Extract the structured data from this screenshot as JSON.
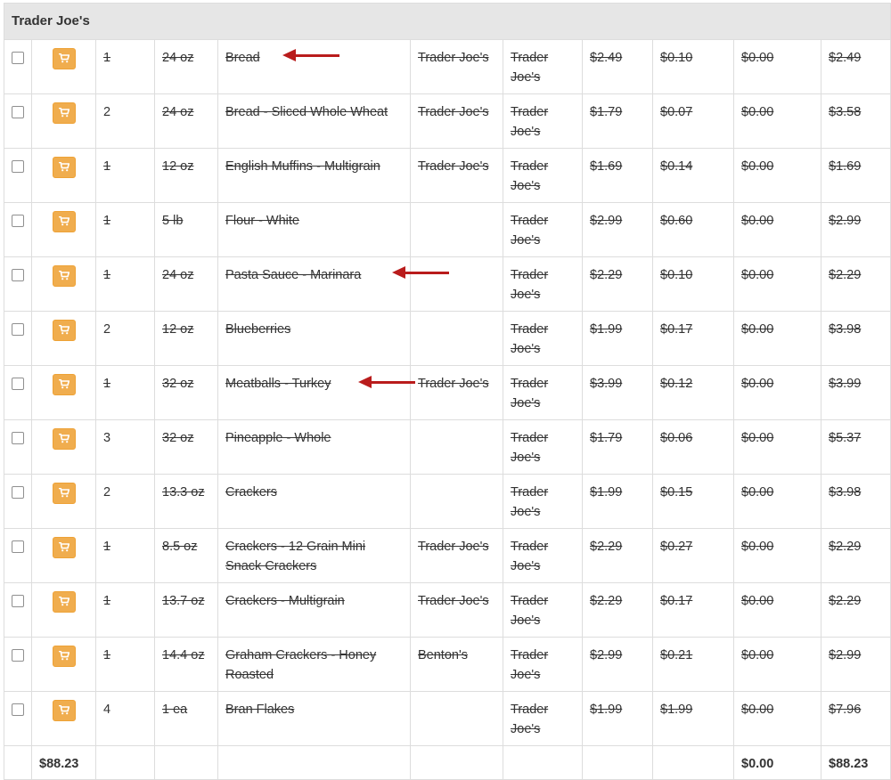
{
  "store": "Trader Joe's",
  "colors": {
    "cart_button": "#f0ad4e",
    "header_bg": "#e6e6e6",
    "annotation_arrow": "#b91c1c",
    "border": "#dddddd"
  },
  "rows": [
    {
      "qty": "1",
      "size": "24 oz",
      "name": "Bread",
      "brand": "Trader Joe's",
      "store": "Trader Joe's",
      "price": "$2.49",
      "unit_price": "$0.10",
      "discount": "$0.00",
      "total": "$2.49",
      "qty_struck": true
    },
    {
      "qty": "2",
      "size": "24 oz",
      "name": "Bread - Sliced Whole Wheat",
      "brand": "Trader Joe's",
      "store": "Trader Joe's",
      "price": "$1.79",
      "unit_price": "$0.07",
      "discount": "$0.00",
      "total": "$3.58",
      "qty_struck": false
    },
    {
      "qty": "1",
      "size": "12 oz",
      "name": "English Muffins - Multigrain",
      "brand": "Trader Joe's",
      "store": "Trader Joe's",
      "price": "$1.69",
      "unit_price": "$0.14",
      "discount": "$0.00",
      "total": "$1.69",
      "qty_struck": true
    },
    {
      "qty": "1",
      "size": "5 lb",
      "name": "Flour - White",
      "brand": "",
      "store": "Trader Joe's",
      "price": "$2.99",
      "unit_price": "$0.60",
      "discount": "$0.00",
      "total": "$2.99",
      "qty_struck": true
    },
    {
      "qty": "1",
      "size": "24 oz",
      "name": "Pasta Sauce - Marinara",
      "brand": "",
      "store": "Trader Joe's",
      "price": "$2.29",
      "unit_price": "$0.10",
      "discount": "$0.00",
      "total": "$2.29",
      "qty_struck": true
    },
    {
      "qty": "2",
      "size": "12 oz",
      "name": "Blueberries",
      "brand": "",
      "store": "Trader Joe's",
      "price": "$1.99",
      "unit_price": "$0.17",
      "discount": "$0.00",
      "total": "$3.98",
      "qty_struck": false
    },
    {
      "qty": "1",
      "size": "32 oz",
      "name": "Meatballs - Turkey",
      "brand": "Trader Joe's",
      "store": "Trader Joe's",
      "price": "$3.99",
      "unit_price": "$0.12",
      "discount": "$0.00",
      "total": "$3.99",
      "qty_struck": true
    },
    {
      "qty": "3",
      "size": "32 oz",
      "name": "Pineapple - Whole",
      "brand": "",
      "store": "Trader Joe's",
      "price": "$1.79",
      "unit_price": "$0.06",
      "discount": "$0.00",
      "total": "$5.37",
      "qty_struck": false
    },
    {
      "qty": "2",
      "size": "13.3 oz",
      "name": "Crackers",
      "brand": "",
      "store": "Trader Joe's",
      "price": "$1.99",
      "unit_price": "$0.15",
      "discount": "$0.00",
      "total": "$3.98",
      "qty_struck": false
    },
    {
      "qty": "1",
      "size": "8.5 oz",
      "name": "Crackers - 12 Grain Mini Snack Crackers",
      "brand": "Trader Joe's",
      "store": "Trader Joe's",
      "price": "$2.29",
      "unit_price": "$0.27",
      "discount": "$0.00",
      "total": "$2.29",
      "qty_struck": true
    },
    {
      "qty": "1",
      "size": "13.7 oz",
      "name": "Crackers - Multigrain",
      "brand": "Trader Joe's",
      "store": "Trader Joe's",
      "price": "$2.29",
      "unit_price": "$0.17",
      "discount": "$0.00",
      "total": "$2.29",
      "qty_struck": true
    },
    {
      "qty": "1",
      "size": "14.4 oz",
      "name": "Graham Crackers - Honey Roasted",
      "brand": "Benton's",
      "store": "Trader Joe's",
      "price": "$2.99",
      "unit_price": "$0.21",
      "discount": "$0.00",
      "total": "$2.99",
      "qty_struck": true
    },
    {
      "qty": "4",
      "size": "1 ea",
      "name": "Bran Flakes",
      "brand": "",
      "store": "Trader Joe's",
      "price": "$1.99",
      "unit_price": "$1.99",
      "discount": "$0.00",
      "total": "$7.96",
      "qty_struck": false
    }
  ],
  "footer": {
    "grand_total_left": "$88.23",
    "discount_total": "$0.00",
    "grand_total_right": "$88.23"
  }
}
